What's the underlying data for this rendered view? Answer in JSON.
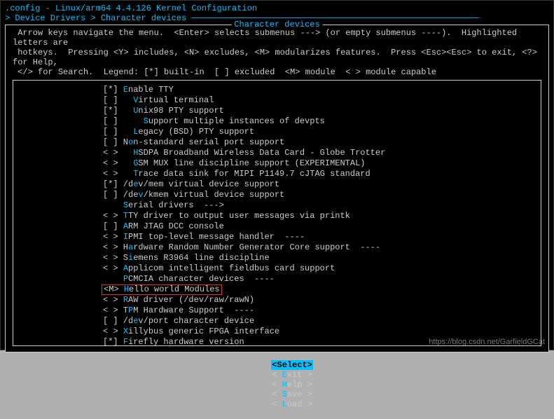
{
  "status_line1": ".config - Linux/arm64 4.4.126 Kernel Configuration",
  "status_line2": "> Device Drivers > Character devices ─────────────────────────────────────────────────────────",
  "frame_title": "Character devices",
  "help_text": " Arrow keys navigate the menu.  <Enter> selects submenus ---> (or empty submenus ----).  Highlighted letters are\n hotkeys.  Pressing <Y> includes, <N> excludes, <M> modularizes features.  Press <Esc><Esc> to exit, <?> for Help,\n </> for Search.  Legend: [*] built-in  [ ] excluded  <M> module  < > module capable",
  "items": [
    {
      "sel": "[*]",
      "pre": "",
      "hot": "E",
      "rest": "nable TTY"
    },
    {
      "sel": "[ ]",
      "pre": "  ",
      "hot": "V",
      "rest": "irtual terminal"
    },
    {
      "sel": "[*]",
      "pre": "  ",
      "hot": "U",
      "rest": "nix98 PTY support"
    },
    {
      "sel": "[ ]",
      "pre": "    ",
      "hot": "S",
      "rest": "upport multiple instances of devpts"
    },
    {
      "sel": "[ ]",
      "pre": "  ",
      "hot": "L",
      "rest": "egacy (BSD) PTY support"
    },
    {
      "sel": "[ ]",
      "pre": "N",
      "hot": "o",
      "rest": "n-standard serial port support"
    },
    {
      "sel": "< >",
      "pre": "  ",
      "hot": "H",
      "rest": "SDPA Broadband Wireless Data Card - Globe Trotter"
    },
    {
      "sel": "< >",
      "pre": "  ",
      "hot": "G",
      "rest": "SM MUX line discipline support (EXPERIMENTAL)"
    },
    {
      "sel": "< >",
      "pre": "  ",
      "hot": "T",
      "rest": "race data sink for MIPI P1149.7 cJTAG standard"
    },
    {
      "sel": "[*]",
      "pre": "/d",
      "hot": "e",
      "rest": "v/mem virtual device support"
    },
    {
      "sel": "[ ]",
      "pre": "/de",
      "hot": "v",
      "rest": "/kmem virtual device support"
    },
    {
      "sel": "   ",
      "pre": "",
      "hot": "S",
      "rest": "erial drivers  --->"
    },
    {
      "sel": "< >",
      "pre": "",
      "hot": "T",
      "rest": "TY driver to output user messages via printk"
    },
    {
      "sel": "[ ]",
      "pre": "",
      "hot": "A",
      "rest": "RM JTAG DCC console"
    },
    {
      "sel": "< >",
      "pre": "",
      "hot": "I",
      "rest": "PMI top-level message handler  ----"
    },
    {
      "sel": "< >",
      "pre": "H",
      "hot": "a",
      "rest": "rdware Random Number Generator Core support  ----"
    },
    {
      "sel": "< >",
      "pre": "S",
      "hot": "i",
      "rest": "emens R3964 line discipline"
    },
    {
      "sel": "< >",
      "pre": "",
      "hot": "A",
      "rest": "pplicom intelligent fieldbus card support"
    },
    {
      "sel": "   ",
      "pre": "",
      "hot": "P",
      "rest": "CMCIA character devices  ----"
    },
    {
      "sel": "<M>",
      "pre": "",
      "hot": "H",
      "rest": "ello world Modules",
      "hl": true
    },
    {
      "sel": "< >",
      "pre": "",
      "hot": "R",
      "rest": "AW driver (/dev/raw/rawN)"
    },
    {
      "sel": "< >",
      "pre": "T",
      "hot": "P",
      "rest": "M Hardware Support  ----"
    },
    {
      "sel": "[ ]",
      "pre": "/d",
      "hot": "e",
      "rest": "v/port character device"
    },
    {
      "sel": "< >",
      "pre": "",
      "hot": "X",
      "rest": "illybus generic FPGA interface"
    },
    {
      "sel": "[*]",
      "pre": "",
      "hot": "F",
      "rest": "irefly hardware version"
    }
  ],
  "buttons": {
    "select": "<Select>",
    "exit": "< Exit >",
    "help": "< Help >",
    "save": "< Save >",
    "load": "< Load >"
  },
  "button_hot": {
    "exit": "E",
    "help": "H",
    "save": "S",
    "load": "L"
  },
  "watermark": "https://blog.csdn.net/GarfieldGCat"
}
